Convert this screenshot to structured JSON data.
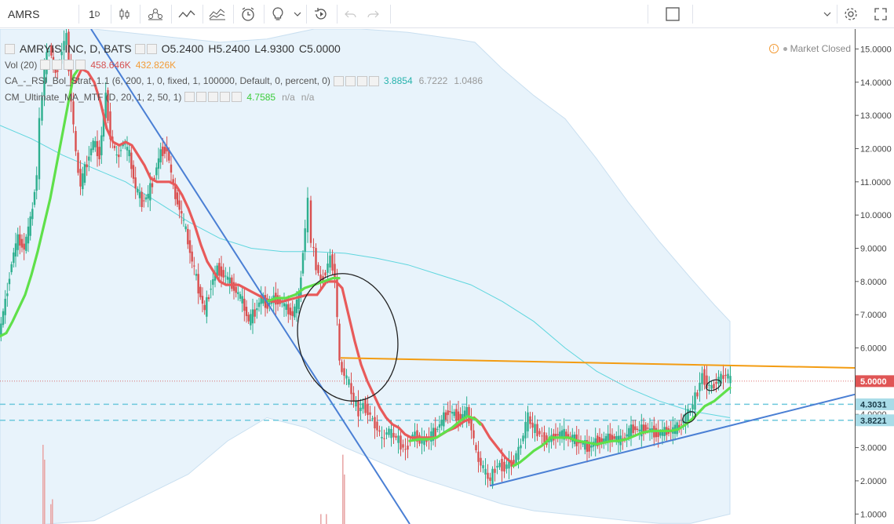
{
  "toolbar": {
    "symbol": "AMRS",
    "interval": "1",
    "interval_unit": "D",
    "icons": [
      "candles-icon",
      "compare-icon",
      "indicators-icon",
      "templates-icon",
      "alert-icon",
      "ideas-icon",
      "replay-icon",
      "undo-icon",
      "redo-icon",
      "layout-icon",
      "settings-icon",
      "fullscreen-icon"
    ]
  },
  "legend": {
    "title": "AMRYIS INC, D, BATS",
    "ohlc": {
      "o": "O5.2400",
      "h": "H5.2400",
      "l": "L4.9300",
      "c": "C5.0000"
    },
    "vol_label": "Vol (20)",
    "vol_values": [
      "458.646K",
      "432.826K"
    ],
    "ind1_label": "CA_-_RSI_Bol_Strat_1.1 (6, 200, 1, 0, fixed, 1, 100000, Default, 0, percent, 0)",
    "ind1_values": [
      "3.8854",
      "6.7222",
      "1.0486"
    ],
    "ind2_label": "CM_Ultimate_MA_MTF (D, 20, 1, 2, 50, 1)",
    "ind2_values": [
      "4.7585",
      "n/a",
      "n/a"
    ]
  },
  "market_status": "Market Closed",
  "colors": {
    "up": "#2eaf8f",
    "down": "#d94f4f",
    "ma_red": "#e85a5a",
    "ma_green": "#5fe04a",
    "band": "#e8f3fb",
    "cyan": "#5fd6de",
    "orange": "#f39c12",
    "blue_line": "#4a7fd4",
    "dashed": "#6dc8dc"
  },
  "chart_data": {
    "type": "candlestick",
    "title": "AMRYIS INC, D, BATS",
    "y_ticks": [
      15,
      14,
      13,
      12,
      11,
      10,
      9,
      8,
      7,
      6,
      5,
      4,
      3,
      2,
      1
    ],
    "y_tick_labels": [
      "15.0000",
      "14.0000",
      "13.0000",
      "12.0000",
      "11.0000",
      "10.0000",
      "9.0000",
      "8.0000",
      "7.0000",
      "6.0000",
      "5.0000",
      "4.0000",
      "3.0000",
      "2.0000",
      "1.0000"
    ],
    "ylim": [
      0.7,
      15.6
    ],
    "last_price": {
      "value": 5.0,
      "label": "5.0000"
    },
    "dashed_levels": [
      {
        "value": 4.3031,
        "label": "4.3031"
      },
      {
        "value": 3.8221,
        "label": "3.8221"
      }
    ],
    "price_path": [
      [
        0,
        6.4
      ],
      [
        8,
        7.4
      ],
      [
        16,
        8.6
      ],
      [
        24,
        9.3
      ],
      [
        32,
        9.0
      ],
      [
        40,
        9.8
      ],
      [
        48,
        11.2
      ],
      [
        52,
        12.8
      ],
      [
        58,
        14.4
      ],
      [
        64,
        15.1
      ],
      [
        72,
        14.2
      ],
      [
        80,
        15.0
      ],
      [
        86,
        15.4
      ],
      [
        92,
        13.5
      ],
      [
        98,
        11.8
      ],
      [
        104,
        10.9
      ],
      [
        112,
        11.6
      ],
      [
        120,
        12.2
      ],
      [
        128,
        11.8
      ],
      [
        136,
        13.6
      ],
      [
        142,
        12.4
      ],
      [
        150,
        11.7
      ],
      [
        158,
        12.2
      ],
      [
        166,
        11.8
      ],
      [
        174,
        10.8
      ],
      [
        182,
        10.4
      ],
      [
        190,
        10.6
      ],
      [
        198,
        11.2
      ],
      [
        206,
        11.9
      ],
      [
        214,
        12.0
      ],
      [
        222,
        10.8
      ],
      [
        230,
        10.2
      ],
      [
        238,
        9.5
      ],
      [
        246,
        8.6
      ],
      [
        254,
        7.8
      ],
      [
        262,
        7.1
      ],
      [
        270,
        7.9
      ],
      [
        278,
        8.4
      ],
      [
        286,
        8.2
      ],
      [
        294,
        8.0
      ],
      [
        302,
        7.7
      ],
      [
        310,
        7.4
      ],
      [
        318,
        6.8
      ],
      [
        326,
        7.1
      ],
      [
        334,
        7.5
      ],
      [
        342,
        7.3
      ],
      [
        350,
        7.5
      ],
      [
        358,
        7.4
      ],
      [
        366,
        7.2
      ],
      [
        374,
        7.0
      ],
      [
        382,
        7.5
      ],
      [
        390,
        9.6
      ],
      [
        394,
        10.4
      ],
      [
        398,
        9.2
      ],
      [
        404,
        8.5
      ],
      [
        410,
        8.0
      ],
      [
        416,
        8.3
      ],
      [
        422,
        8.7
      ],
      [
        428,
        8.2
      ],
      [
        434,
        5.5
      ],
      [
        440,
        5.2
      ],
      [
        446,
        4.9
      ],
      [
        452,
        4.4
      ],
      [
        458,
        4.1
      ],
      [
        464,
        4.3
      ],
      [
        470,
        4.1
      ],
      [
        476,
        3.8
      ],
      [
        482,
        3.6
      ],
      [
        488,
        3.2
      ],
      [
        494,
        3.5
      ],
      [
        500,
        3.4
      ],
      [
        506,
        3.3
      ],
      [
        512,
        3.1
      ],
      [
        518,
        2.9
      ],
      [
        524,
        3.3
      ],
      [
        530,
        3.4
      ],
      [
        536,
        3.2
      ],
      [
        542,
        3.2
      ],
      [
        548,
        3.3
      ],
      [
        556,
        3.5
      ],
      [
        564,
        3.8
      ],
      [
        572,
        4.1
      ],
      [
        580,
        4.0
      ],
      [
        588,
        3.9
      ],
      [
        596,
        4.1
      ],
      [
        602,
        3.6
      ],
      [
        608,
        2.8
      ],
      [
        614,
        2.5
      ],
      [
        620,
        2.2
      ],
      [
        626,
        2.0
      ],
      [
        632,
        2.4
      ],
      [
        638,
        2.5
      ],
      [
        644,
        2.4
      ],
      [
        650,
        2.5
      ],
      [
        656,
        2.6
      ],
      [
        662,
        2.9
      ],
      [
        668,
        3.4
      ],
      [
        674,
        3.9
      ],
      [
        680,
        3.6
      ],
      [
        686,
        3.5
      ],
      [
        692,
        3.3
      ],
      [
        698,
        3.2
      ],
      [
        704,
        3.3
      ],
      [
        712,
        3.4
      ],
      [
        720,
        3.4
      ],
      [
        728,
        3.3
      ],
      [
        736,
        3.2
      ],
      [
        744,
        3.1
      ],
      [
        752,
        3.0
      ],
      [
        760,
        3.2
      ],
      [
        768,
        3.2
      ],
      [
        776,
        3.3
      ],
      [
        784,
        3.3
      ],
      [
        792,
        3.2
      ],
      [
        800,
        3.4
      ],
      [
        808,
        3.6
      ],
      [
        816,
        3.5
      ],
      [
        824,
        3.6
      ],
      [
        832,
        3.5
      ],
      [
        840,
        3.4
      ],
      [
        848,
        3.5
      ],
      [
        856,
        3.5
      ],
      [
        864,
        3.6
      ],
      [
        872,
        3.8
      ],
      [
        878,
        4.0
      ],
      [
        884,
        4.3
      ],
      [
        890,
        4.7
      ],
      [
        896,
        5.2
      ],
      [
        902,
        4.9
      ],
      [
        908,
        4.8
      ],
      [
        914,
        5.0
      ],
      [
        920,
        5.1
      ],
      [
        926,
        5.2
      ],
      [
        932,
        5.0
      ]
    ],
    "red_ma": [
      [
        96,
        14.0
      ],
      [
        104,
        14.4
      ],
      [
        112,
        14.3
      ],
      [
        120,
        14.0
      ],
      [
        128,
        13.4
      ],
      [
        136,
        12.6
      ],
      [
        144,
        12.2
      ],
      [
        152,
        12.1
      ],
      [
        160,
        12.2
      ],
      [
        168,
        12.1
      ],
      [
        176,
        11.8
      ],
      [
        184,
        11.5
      ],
      [
        192,
        11.1
      ],
      [
        200,
        11.0
      ],
      [
        208,
        11.0
      ],
      [
        216,
        11.0
      ],
      [
        224,
        10.9
      ],
      [
        232,
        10.6
      ],
      [
        240,
        10.2
      ],
      [
        248,
        9.7
      ],
      [
        256,
        9.1
      ],
      [
        264,
        8.6
      ],
      [
        272,
        8.3
      ],
      [
        280,
        8.0
      ],
      [
        288,
        7.9
      ],
      [
        296,
        7.9
      ],
      [
        304,
        7.9
      ],
      [
        312,
        7.8
      ],
      [
        320,
        7.7
      ],
      [
        328,
        7.6
      ],
      [
        336,
        7.5
      ],
      [
        346,
        7.4
      ],
      [
        360,
        7.4
      ],
      [
        376,
        7.5
      ],
      [
        392,
        7.6
      ],
      [
        404,
        7.6
      ],
      [
        416,
        8.0
      ],
      [
        428,
        8.0
      ],
      [
        436,
        7.8
      ],
      [
        444,
        7.0
      ],
      [
        452,
        6.2
      ],
      [
        460,
        5.5
      ],
      [
        468,
        5.0
      ],
      [
        476,
        4.6
      ],
      [
        484,
        4.2
      ],
      [
        492,
        3.9
      ],
      [
        500,
        3.7
      ],
      [
        508,
        3.6
      ],
      [
        516,
        3.4
      ],
      [
        524,
        3.3
      ],
      [
        540,
        3.3
      ],
      [
        556,
        3.3
      ],
      [
        570,
        3.5
      ],
      [
        580,
        3.6
      ],
      [
        592,
        3.8
      ],
      [
        604,
        3.9
      ],
      [
        614,
        3.7
      ],
      [
        624,
        3.3
      ],
      [
        634,
        3.0
      ],
      [
        644,
        2.7
      ],
      [
        654,
        2.5
      ]
    ],
    "green_ma": [
      [
        0,
        6.35
      ],
      [
        8,
        6.45
      ],
      [
        16,
        6.8
      ],
      [
        24,
        7.2
      ],
      [
        32,
        7.6
      ],
      [
        40,
        8.2
      ],
      [
        48,
        8.9
      ],
      [
        56,
        9.7
      ],
      [
        64,
        10.5
      ],
      [
        72,
        11.5
      ],
      [
        80,
        12.5
      ],
      [
        88,
        13.5
      ],
      [
        94,
        14.2
      ],
      [
        100,
        14.4
      ],
      [
        700,
        3.3
      ],
      [
        706,
        3.3
      ],
      [
        714,
        3.3
      ],
      [
        724,
        3.3
      ],
      [
        736,
        3.2
      ],
      [
        748,
        3.15
      ],
      [
        760,
        3.1
      ],
      [
        770,
        3.15
      ],
      [
        780,
        3.2
      ],
      [
        788,
        3.2
      ],
      [
        798,
        3.25
      ],
      [
        808,
        3.35
      ],
      [
        818,
        3.45
      ],
      [
        830,
        3.5
      ],
      [
        842,
        3.5
      ],
      [
        854,
        3.5
      ],
      [
        864,
        3.55
      ],
      [
        874,
        3.7
      ],
      [
        886,
        3.95
      ],
      [
        898,
        4.25
      ],
      [
        910,
        4.4
      ],
      [
        920,
        4.6
      ],
      [
        930,
        4.8
      ]
    ],
    "green_ma_mid": [
      [
        340,
        7.4
      ],
      [
        352,
        7.5
      ],
      [
        364,
        7.5
      ],
      [
        376,
        7.6
      ],
      [
        388,
        7.8
      ],
      [
        400,
        7.9
      ],
      [
        412,
        8.0
      ],
      [
        424,
        8.1
      ],
      [
        432,
        8.1
      ]
    ],
    "green_ma_low": [
      [
        522,
        3.2
      ],
      [
        534,
        3.25
      ],
      [
        546,
        3.25
      ],
      [
        556,
        3.3
      ],
      [
        566,
        3.45
      ],
      [
        576,
        3.6
      ],
      [
        586,
        3.8
      ],
      [
        596,
        3.95
      ],
      [
        606,
        3.85
      ],
      [
        612,
        3.7
      ],
      [
        654,
        2.45
      ],
      [
        662,
        2.55
      ],
      [
        670,
        2.7
      ],
      [
        680,
        2.9
      ],
      [
        690,
        3.05
      ],
      [
        700,
        3.25
      ]
    ],
    "cyan_line": [
      [
        0,
        12.7
      ],
      [
        40,
        12.3
      ],
      [
        80,
        11.8
      ],
      [
        120,
        11.4
      ],
      [
        160,
        11.0
      ],
      [
        200,
        10.4
      ],
      [
        240,
        9.8
      ],
      [
        280,
        9.3
      ],
      [
        320,
        9.0
      ],
      [
        360,
        8.9
      ],
      [
        400,
        8.9
      ],
      [
        440,
        8.85
      ],
      [
        480,
        8.7
      ],
      [
        520,
        8.5
      ],
      [
        560,
        8.2
      ],
      [
        600,
        7.9
      ],
      [
        640,
        7.4
      ],
      [
        680,
        6.8
      ],
      [
        720,
        6.0
      ],
      [
        760,
        5.3
      ],
      [
        800,
        4.8
      ],
      [
        840,
        4.4
      ],
      [
        880,
        4.1
      ],
      [
        930,
        3.9
      ]
    ],
    "band_upper": [
      [
        0,
        15.6
      ],
      [
        120,
        15.6
      ],
      [
        200,
        15.4
      ],
      [
        280,
        15.2
      ],
      [
        340,
        15.3
      ],
      [
        400,
        15.6
      ],
      [
        460,
        15.6
      ],
      [
        520,
        15.5
      ],
      [
        580,
        15.3
      ],
      [
        605,
        15.2
      ],
      [
        640,
        14.4
      ],
      [
        680,
        13.6
      ],
      [
        720,
        12.9
      ],
      [
        760,
        11.7
      ],
      [
        800,
        10.4
      ],
      [
        840,
        9.2
      ],
      [
        880,
        8.1
      ],
      [
        910,
        7.3
      ],
      [
        930,
        6.8
      ]
    ],
    "band_lower": [
      [
        0,
        0.6
      ],
      [
        60,
        0.7
      ],
      [
        120,
        0.8
      ],
      [
        180,
        1.5
      ],
      [
        240,
        2.2
      ],
      [
        290,
        3.2
      ],
      [
        340,
        3.9
      ],
      [
        390,
        3.6
      ],
      [
        440,
        3.0
      ],
      [
        480,
        2.6
      ],
      [
        520,
        2.2
      ],
      [
        560,
        1.9
      ],
      [
        600,
        1.6
      ],
      [
        640,
        1.3
      ],
      [
        680,
        1.1
      ],
      [
        720,
        1.0
      ],
      [
        760,
        0.9
      ],
      [
        800,
        0.8
      ],
      [
        840,
        0.72
      ],
      [
        880,
        0.72
      ],
      [
        930,
        1.0
      ]
    ],
    "trendlines": [
      {
        "name": "downtrend",
        "color": "#4a7fd4",
        "from": [
          116,
          15.6
        ],
        "to": [
          522,
          0.7
        ]
      },
      {
        "name": "uptrend",
        "color": "#4a7fd4",
        "from": [
          624,
          1.85
        ],
        "to": [
          1089,
          4.6
        ]
      },
      {
        "name": "resistance",
        "color": "#f39c12",
        "from": [
          434,
          5.7
        ],
        "to": [
          1089,
          5.4
        ]
      }
    ],
    "volume_bars": [
      [
        54,
        0.16
      ],
      [
        56,
        0.13
      ],
      [
        64,
        0.04
      ],
      [
        66,
        0.05
      ],
      [
        436,
        0.14
      ],
      [
        438,
        0.1
      ],
      [
        408,
        0.02
      ],
      [
        415,
        0.02
      ]
    ]
  }
}
